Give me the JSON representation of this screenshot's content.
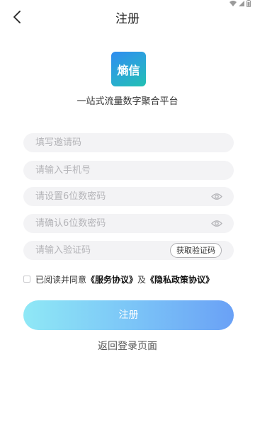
{
  "status_bar": {
    "icons": [
      "wifi-icon",
      "signal-icon",
      "battery-icon"
    ]
  },
  "nav": {
    "back_icon": "chevron-left-icon",
    "title": "注册"
  },
  "brand": {
    "logo_text": "熵信",
    "slogan": "一站式流量数字聚合平台",
    "logo_colors": [
      "#2f8cf0",
      "#22c0b2"
    ]
  },
  "form": {
    "invite_code": {
      "placeholder": "填写邀请码",
      "value": ""
    },
    "phone": {
      "placeholder": "请输入手机号",
      "value": ""
    },
    "password": {
      "placeholder": "请设置6位数密码",
      "value": "",
      "icon": "eye-icon"
    },
    "password_confirm": {
      "placeholder": "请确认6位数密码",
      "value": "",
      "icon": "eye-icon"
    },
    "verify_code": {
      "placeholder": "请输入验证码",
      "value": ""
    },
    "get_code_label": "获取验证码"
  },
  "agreement": {
    "checked": false,
    "prefix": "已阅读并同意",
    "service_link": "《服务协议》",
    "joiner": "及",
    "privacy_link": "《隐私政策协议》"
  },
  "actions": {
    "register_label": "注册",
    "back_to_login_label": "返回登录页面",
    "register_gradient": [
      "#8fe8f6",
      "#6aa1f6"
    ]
  }
}
